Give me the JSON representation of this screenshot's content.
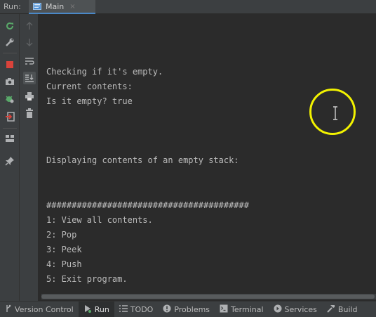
{
  "run_panel": {
    "label": "Run:",
    "tab": {
      "title": "Main",
      "close": "×"
    }
  },
  "console": {
    "lines": [
      "Checking if it's empty.",
      "Current contents:",
      "Is it empty? true",
      "Displaying contents of an empty stack:",
      "########################################",
      "1: View all contents.",
      "2: Pop",
      "3: Peek",
      "4: Push",
      "5: Exit program."
    ]
  },
  "left_toolbar": {
    "icons": [
      "rerun-icon",
      "wrench-icon",
      "stop-icon",
      "camera-icon",
      "debug-settings-icon",
      "exit-icon",
      "layout-icon",
      "pin-icon"
    ]
  },
  "right_toolbar": {
    "icons": [
      "up-arrow-icon",
      "down-arrow-icon",
      "soft-wrap-icon",
      "scroll-to-end-icon",
      "print-icon",
      "trash-icon"
    ]
  },
  "bottom_bar": {
    "items": [
      {
        "label": "Version Control",
        "icon": "version-control-icon"
      },
      {
        "label": "Run",
        "icon": "run-icon",
        "active": true
      },
      {
        "label": "TODO",
        "icon": "todo-icon"
      },
      {
        "label": "Problems",
        "icon": "problems-icon"
      },
      {
        "label": "Terminal",
        "icon": "terminal-icon"
      },
      {
        "label": "Services",
        "icon": "services-icon"
      },
      {
        "label": "Build",
        "icon": "build-icon"
      }
    ]
  },
  "colors": {
    "highlight_ring": "#f2f200",
    "console_bg": "#2b2b2b",
    "panel_bg": "#3c3f41"
  }
}
